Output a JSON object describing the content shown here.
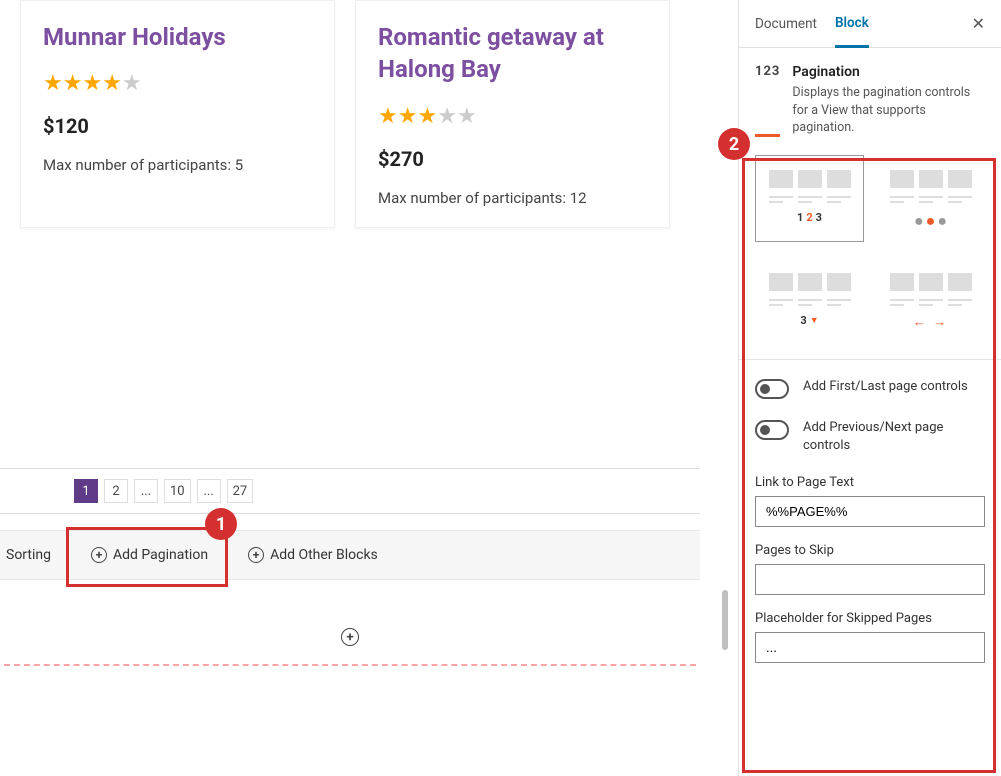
{
  "cards": [
    {
      "title": "Munnar Holidays",
      "price": "$120",
      "rating": 4,
      "meta": "Max number of participants: 5"
    },
    {
      "title": "Romantic getaway at Halong Bay",
      "price": "$270",
      "rating": 3,
      "meta": "Max number of participants: 12"
    }
  ],
  "pagination": {
    "pages": [
      "1",
      "2",
      "...",
      "10",
      "...",
      "27"
    ],
    "active": 0
  },
  "actions": {
    "sorting": "Sorting",
    "add_pagination": "Add Pagination",
    "add_other": "Add Other Blocks"
  },
  "sidebar": {
    "tabs": {
      "document": "Document",
      "block": "Block"
    },
    "block": {
      "icon": "123",
      "title": "Pagination",
      "desc": "Displays the pagination controls for a View that supports pagination."
    },
    "styles": {
      "opt1": {
        "n1": "1",
        "n2": "2",
        "n3": "3"
      },
      "opt3": {
        "n": "3"
      }
    },
    "toggles": {
      "first_last": "Add First/Last page controls",
      "prev_next": "Add Previous/Next page controls"
    },
    "fields": {
      "link_text_label": "Link to Page Text",
      "link_text_value": "%%PAGE%%",
      "pages_skip_label": "Pages to Skip",
      "pages_skip_value": "",
      "placeholder_label": "Placeholder for Skipped Pages",
      "placeholder_value": "..."
    }
  },
  "badges": {
    "one": "1",
    "two": "2"
  }
}
